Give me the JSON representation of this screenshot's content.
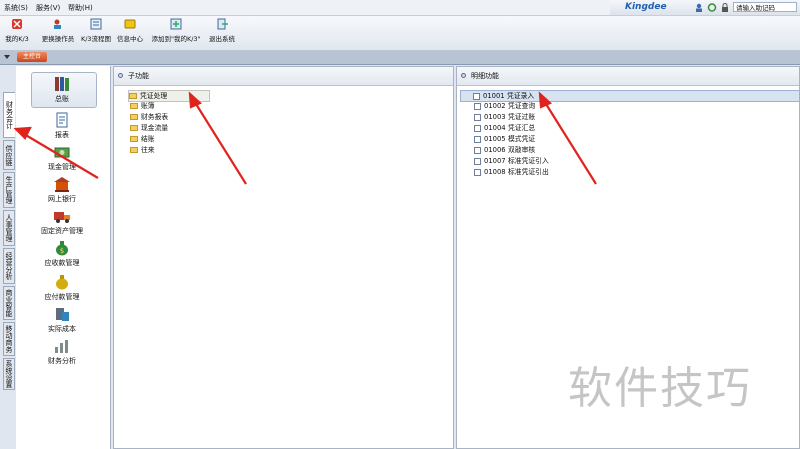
{
  "menubar": {
    "items": [
      "系统(S)",
      "服务(V)",
      "帮助(H)"
    ],
    "search_placeholder": "请输入助记码",
    "brand": "Kingdee"
  },
  "toolbar": {
    "buttons": [
      {
        "label": "我的K/3",
        "icon": "my-k3-icon"
      },
      {
        "label": "更换操作员",
        "icon": "change-operator-icon"
      },
      {
        "label": "K/3流程图",
        "icon": "flowchart-icon"
      },
      {
        "label": "信息中心",
        "icon": "message-center-icon"
      },
      {
        "label": "添加到\"我的K/3\"",
        "icon": "add-favorite-icon"
      },
      {
        "label": "退出系统",
        "icon": "exit-icon"
      }
    ]
  },
  "tabs": {
    "main": "主控台"
  },
  "vertical_tabs": [
    "财务会计",
    "供应链",
    "生产管理",
    "人事管理",
    "经营分析",
    "商业智能",
    "移动商务",
    "系统设置"
  ],
  "modules": [
    "总账",
    "报表",
    "现金管理",
    "网上银行",
    "固定资产管理",
    "应收款管理",
    "应付款管理",
    "实际成本",
    "财务分析"
  ],
  "sub_panel": {
    "title": "子功能",
    "items": [
      "凭证处理",
      "账簿",
      "财务报表",
      "现金流量",
      "结账",
      "往来"
    ]
  },
  "detail_panel": {
    "title": "明细功能",
    "items": [
      {
        "code": "01001",
        "name": "凭证录入"
      },
      {
        "code": "01002",
        "name": "凭证查询"
      },
      {
        "code": "01003",
        "name": "凭证过账"
      },
      {
        "code": "01004",
        "name": "凭证汇总"
      },
      {
        "code": "01005",
        "name": "模式凭证"
      },
      {
        "code": "01006",
        "name": "双敲审核"
      },
      {
        "code": "01007",
        "name": "标准凭证引入"
      },
      {
        "code": "01008",
        "name": "标准凭证引出"
      }
    ]
  },
  "watermark": "软件技巧",
  "colors": {
    "arrow": "#e0231c",
    "accent_tab": "#d4552a"
  }
}
